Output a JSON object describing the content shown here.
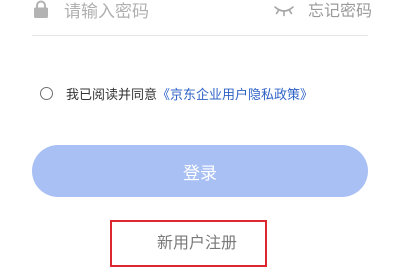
{
  "password_field": {
    "placeholder": "请输入密码",
    "value": "",
    "lock_icon": "lock-icon",
    "visibility_icon": "eye-closed-icon"
  },
  "forgot_password_label": "忘记密码",
  "agreement": {
    "prefix": "我已阅读并同意",
    "policy_link": "《京东企业用户隐私政策》",
    "checked": false
  },
  "login_button_label": "登录",
  "register_link_label": "新用户注册",
  "colors": {
    "primary_button": "#a9c0f4",
    "link": "#2f63c6",
    "highlight_box": "#dc2630"
  }
}
